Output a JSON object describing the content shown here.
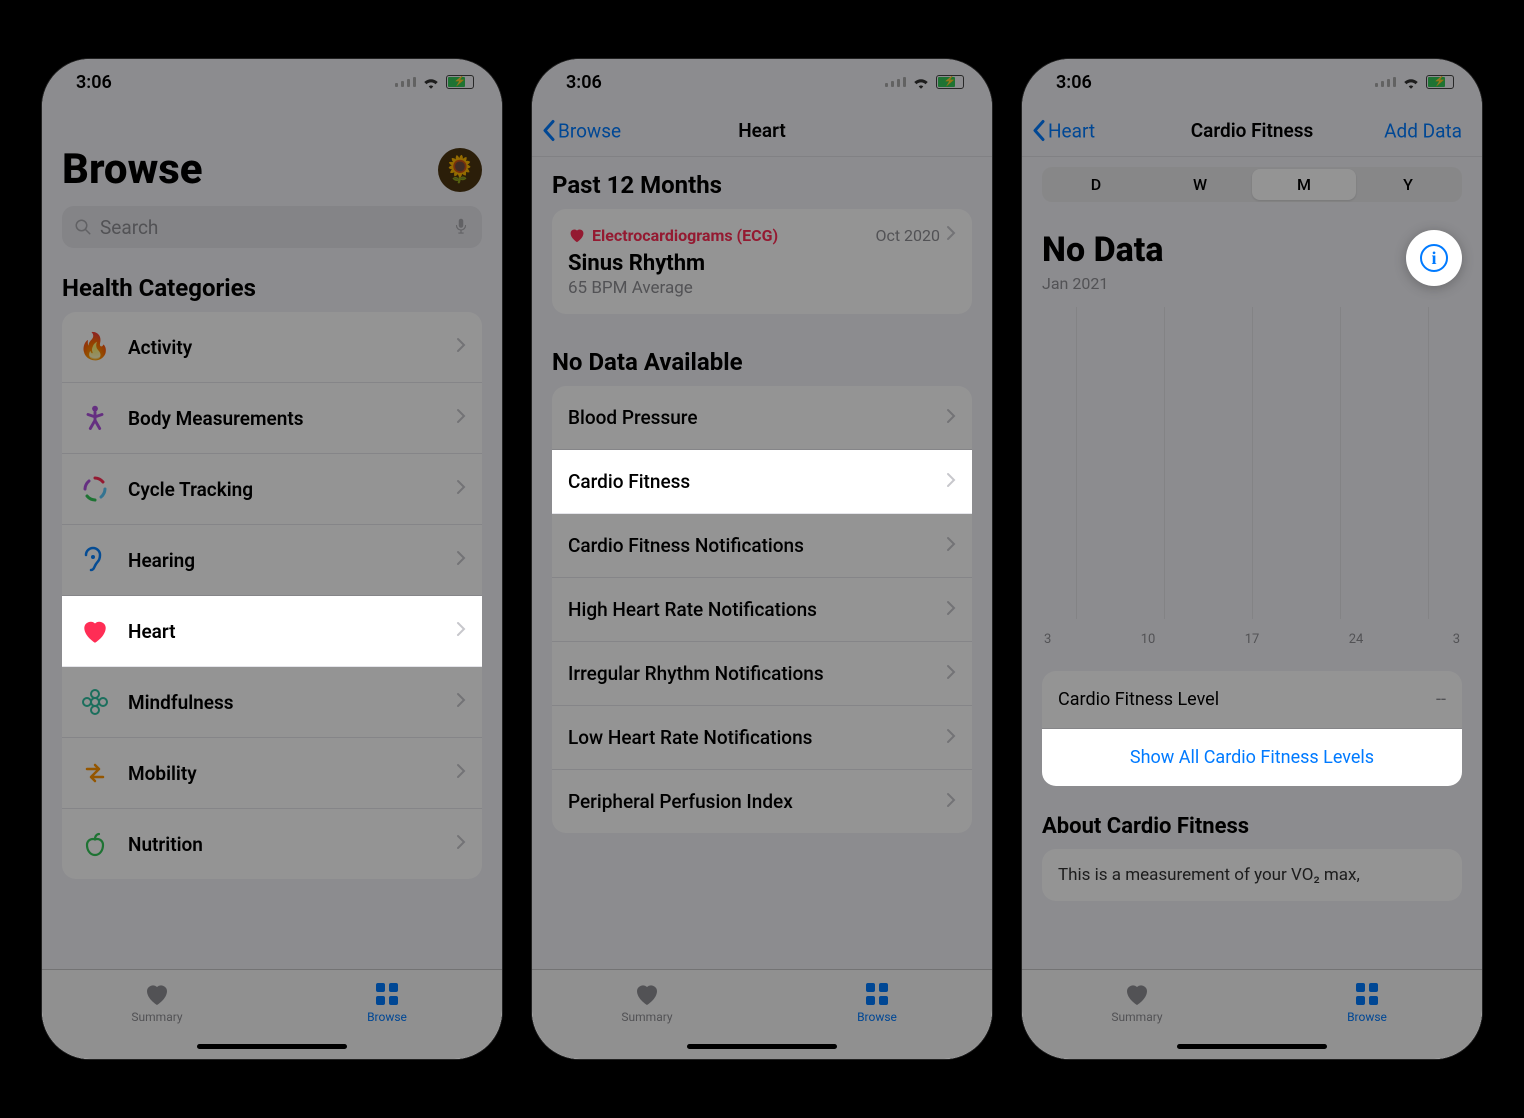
{
  "status": {
    "time": "3:06"
  },
  "screen1": {
    "title": "Browse",
    "search_placeholder": "Search",
    "section": "Health Categories",
    "categories": [
      {
        "label": "Activity",
        "icon": "activity-flame-icon",
        "color": "#ff3b30"
      },
      {
        "label": "Body Measurements",
        "icon": "body-icon",
        "color": "#af52de"
      },
      {
        "label": "Cycle Tracking",
        "icon": "cycle-icon",
        "color": "#ff2d55"
      },
      {
        "label": "Hearing",
        "icon": "ear-icon",
        "color": "#0a84ff"
      },
      {
        "label": "Heart",
        "icon": "heart-icon",
        "color": "#ff2d55"
      },
      {
        "label": "Mindfulness",
        "icon": "mindfulness-icon",
        "color": "#30d158"
      },
      {
        "label": "Mobility",
        "icon": "mobility-icon",
        "color": "#ff9500"
      },
      {
        "label": "Nutrition",
        "icon": "nutrition-icon",
        "color": "#34c759"
      }
    ]
  },
  "screen2": {
    "back": "Browse",
    "title": "Heart",
    "past_label": "Past 12 Months",
    "ecg": {
      "name": "Electrocardiograms (ECG)",
      "date": "Oct 2020",
      "result": "Sinus Rhythm",
      "sub": "65 BPM Average"
    },
    "nodata_label": "No Data Available",
    "items": [
      "Blood Pressure",
      "Cardio Fitness",
      "Cardio Fitness Notifications",
      "High Heart Rate Notifications",
      "Irregular Rhythm Notifications",
      "Low Heart Rate Notifications",
      "Peripheral Perfusion Index"
    ]
  },
  "screen3": {
    "back": "Heart",
    "title": "Cardio Fitness",
    "action": "Add Data",
    "segments": [
      "D",
      "W",
      "M",
      "Y"
    ],
    "segment_selected": "M",
    "nodata": "No Data",
    "date": "Jan 2021",
    "xlabels": [
      "3",
      "10",
      "17",
      "24",
      "3"
    ],
    "level_label": "Cardio Fitness Level",
    "level_value": "--",
    "show_all": "Show All Cardio Fitness Levels",
    "about_title": "About Cardio Fitness",
    "about_body": "This is a measurement of your VO₂ max,"
  },
  "tabs": {
    "summary": "Summary",
    "browse": "Browse"
  }
}
